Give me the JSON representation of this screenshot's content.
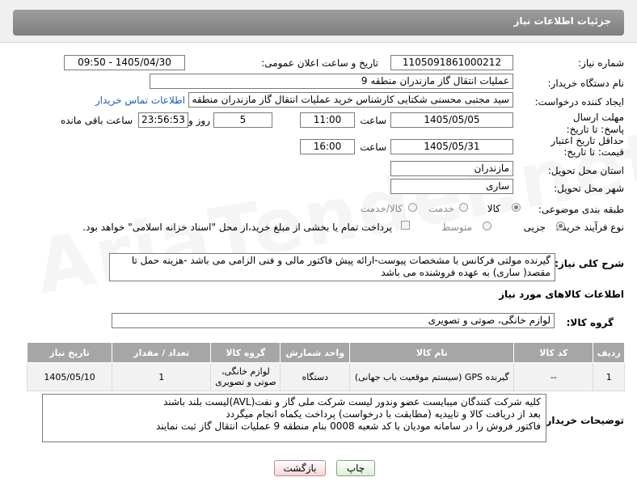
{
  "header": {
    "title": "جزئیات اطلاعات نیاز"
  },
  "watermark": "AriaTender.net",
  "form": {
    "need_number_label": "شماره نیاز:",
    "need_number": "1105091861000212",
    "announce_label": "تاریخ و ساعت اعلان عمومی:",
    "announce_value": "1405/04/30 - 09:50",
    "buyer_org_label": "نام دستگاه خریدار:",
    "buyer_org": "عملیات انتقال گاز مازندران منطقه 9",
    "creator_label": "ایجاد کننده درخواست:",
    "creator": "سید مجتبی محسنی شکتایی کارشناس خرید عملیات انتقال گاز مازندران منطقه",
    "contact_link": "اطلاعات تماس خریدار",
    "deadline_label": "مهلت ارسال پاسخ: تا تاریخ:",
    "deadline_date": "1405/05/05",
    "time_label": "ساعت",
    "deadline_time": "11:00",
    "days_value": "5",
    "days_label": "روز و",
    "remaining_time": "23:56:53",
    "remaining_label": "ساعت باقی مانده",
    "price_validity_label": "حداقل تاریخ اعتبار قیمت: تا تاریخ:",
    "price_date": "1405/05/31",
    "price_time_label": "ساعت",
    "price_time": "16:00",
    "province_label": "استان محل تحویل:",
    "province": "مازندران",
    "city_label": "شهر محل تحویل:",
    "city": "ساری",
    "category_label": "طبقه بندی موضوعی:",
    "category_options": [
      "کالا",
      "خدمت",
      "کالا/خدمت"
    ],
    "process_label": "نوع فرآیند خرید :",
    "process_options": [
      "جزیی",
      "متوسط"
    ],
    "payment_note": "پرداخت تمام یا بخشی از مبلغ خرید،از محل \"اسناد خزانه اسلامی\" خواهد بود."
  },
  "description": {
    "label": "شرح کلی نیاز:",
    "text": "گیرنده مولتی فرکانس با مشخصات پیوست-ارائه پیش فاکتور مالی و فنی الزامی می باشد -هزینه حمل تا مقصد( ساری) به عهده فروشنده می باشد"
  },
  "goods_section": {
    "title": "اطلاعات کالاهای مورد نیاز",
    "group_label": "گروه کالا:",
    "group_value": "لوازم خانگی، صوتی و تصویری"
  },
  "table": {
    "headers": [
      "ردیف",
      "کد کالا",
      "نام کالا",
      "واحد شمارش",
      "گروه کالا",
      "تعداد / مقدار",
      "تاریخ نیاز"
    ],
    "rows": [
      [
        "1",
        "--",
        "گیرنده GPS (سیستم موقعیت یاب جهانی)",
        "دستگاه",
        "لوازم خانگی، صوتی و تصویری",
        "1",
        "1405/05/10"
      ]
    ]
  },
  "buyer_notes": {
    "label": "توضیحات خریدار:",
    "line1": "کلیه شرکت کنندگان میبایست عضو وندور لیست شرکت ملی گاز و نفت(AVL)لیست بلند باشند",
    "line2": "بعد از دریافت کالا و تاییدیه (مطابقت با درخواست) پرداخت یکماه انجام میگردد",
    "line3": "فاکتور فروش را در سامانه مودیان با کد شعبه 0008 بنام منطقه 9 عملیات انتقال گاز ثبت نمایند"
  },
  "buttons": {
    "print": "چاپ",
    "back": "بازگشت"
  }
}
